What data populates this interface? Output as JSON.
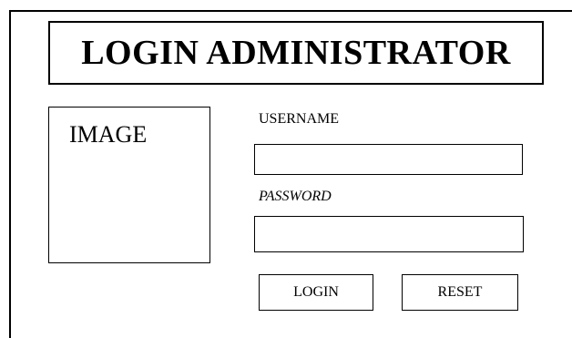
{
  "title": "LOGIN ADMINISTRATOR",
  "image_placeholder": {
    "label": "IMAGE"
  },
  "form": {
    "username": {
      "label": "USERNAME",
      "value": "",
      "placeholder": ""
    },
    "password": {
      "label": "PASSWORD",
      "value": "",
      "placeholder": ""
    },
    "login_button": "LOGIN",
    "reset_button": "RESET"
  }
}
